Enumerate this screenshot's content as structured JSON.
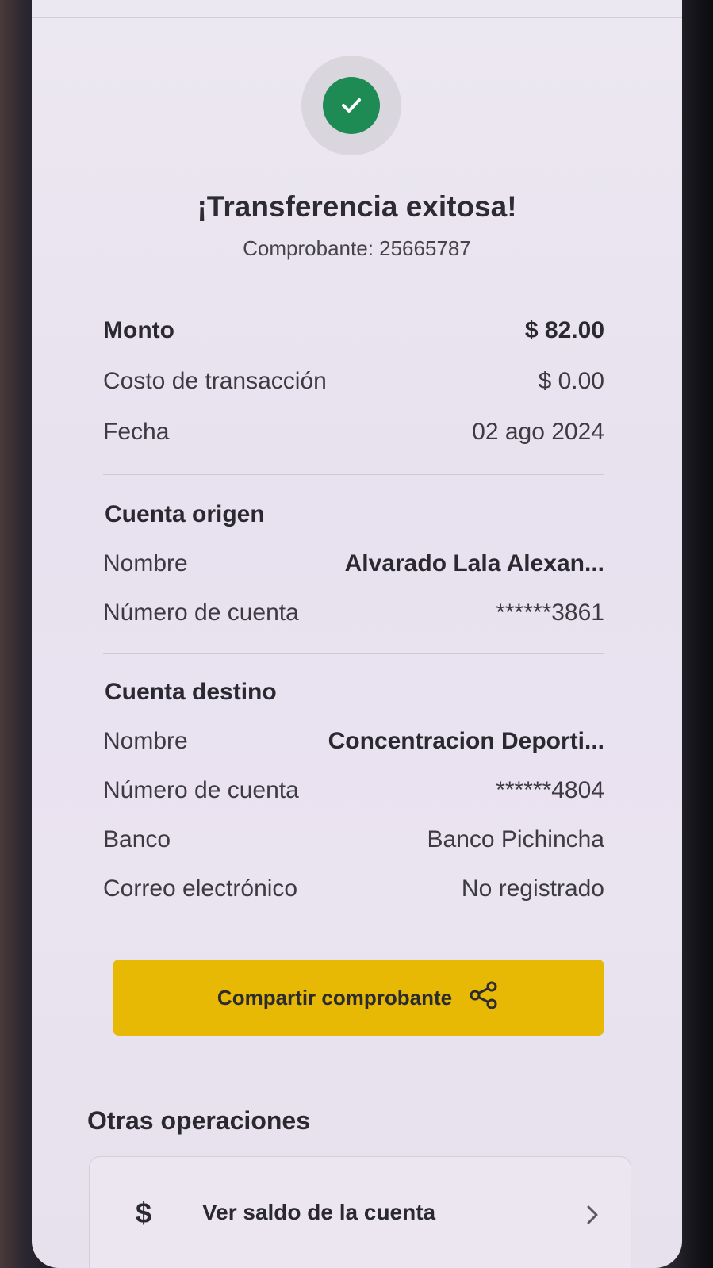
{
  "header": {
    "title": "¡Transferencia exitosa!",
    "voucher": "Comprobante: 25665787",
    "success_color": "#1e8a54"
  },
  "summary": {
    "amount_label": "Monto",
    "amount_value": "$ 82.00",
    "cost_label": "Costo de transacción",
    "cost_value": "$ 0.00",
    "date_label": "Fecha",
    "date_value": "02 ago 2024"
  },
  "origin": {
    "title": "Cuenta origen",
    "name_label": "Nombre",
    "name_value": "Alvarado  Lala Alexan...",
    "account_label": "Número de cuenta",
    "account_value": "******3861"
  },
  "destination": {
    "title": "Cuenta destino",
    "name_label": "Nombre",
    "name_value": "Concentracion Deporti...",
    "account_label": "Número de cuenta",
    "account_value": "******4804",
    "bank_label": "Banco",
    "bank_value": "Banco Pichincha",
    "email_label": "Correo electrónico",
    "email_value": "No registrado"
  },
  "actions": {
    "share_label": "Compartir comprobante",
    "share_color": "#e7b804"
  },
  "other_operations": {
    "title": "Otras operaciones",
    "items": [
      {
        "icon": "dollar-icon",
        "glyph": "$",
        "label": "Ver saldo de la cuenta"
      }
    ]
  }
}
